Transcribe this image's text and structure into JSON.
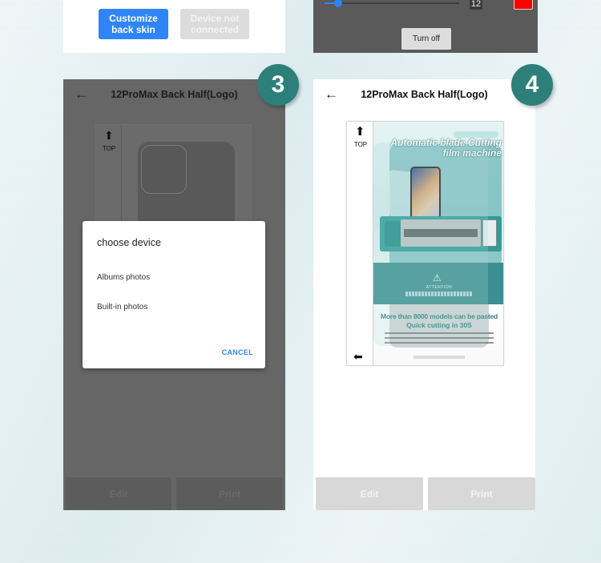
{
  "panel_top_left": {
    "customize_button": "Customize back skin",
    "device_button": "Device not connected"
  },
  "panel_top_right": {
    "slider_value": "12",
    "slider_fraction": 0.1,
    "color_swatch": "#ff0000",
    "turn_off_button": "Turn off"
  },
  "steps": {
    "step3": "3",
    "step4": "4"
  },
  "screen3": {
    "title": "12ProMax Back Half(Logo)",
    "template_top_label": "TOP",
    "dialog": {
      "title": "choose device",
      "items": [
        "Albums photos",
        "Built-in photos"
      ],
      "cancel": "CANCEL"
    },
    "edit_button": "Edit",
    "print_button": "Print"
  },
  "screen4": {
    "title": "12ProMax Back Half(Logo)",
    "template_top_label": "TOP",
    "poster": {
      "headline": "Automatic blade Cutting film machine",
      "attention": "ATTENTION",
      "line1": "More than 8000 models can be pasted",
      "line2": "Quick cutting in 30S"
    },
    "edit_button": "Edit",
    "print_button": "Print"
  },
  "colors": {
    "accent_blue": "#2f85f6",
    "badge_teal": "#2c8079"
  }
}
